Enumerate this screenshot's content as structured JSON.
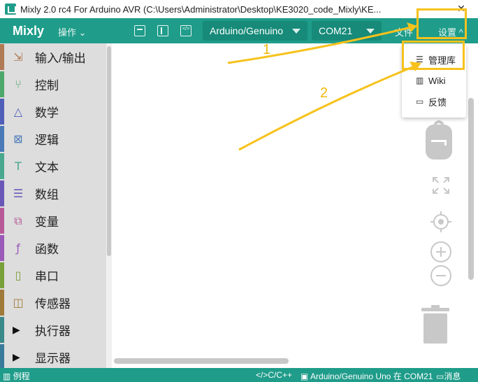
{
  "window": {
    "title": "Mixly 2.0 rc4 For Arduino AVR (C:\\Users\\Administrator\\Desktop\\KE3020_code_Mixly\\KE...",
    "minimize_glyph": "—",
    "close_glyph": "✕"
  },
  "header": {
    "brand": "Mixly",
    "operations_label": "操作",
    "board_select": "Arduino/Genuino",
    "port_select": "COM21",
    "file_menu": "文件",
    "settings_menu": "设置"
  },
  "toolbox": {
    "categories": [
      {
        "label": "输入/输出",
        "color": "#b07a54",
        "icon": "in-out-icon"
      },
      {
        "label": "控制",
        "color": "#4ea86b",
        "icon": "control-icon"
      },
      {
        "label": "数学",
        "color": "#5060b8",
        "icon": "math-icon"
      },
      {
        "label": "逻辑",
        "color": "#4a7ab8",
        "icon": "logic-icon"
      },
      {
        "label": "文本",
        "color": "#4aa88e",
        "icon": "text-icon"
      },
      {
        "label": "数组",
        "color": "#6a58b8",
        "icon": "array-icon"
      },
      {
        "label": "变量",
        "color": "#b85a9a",
        "icon": "variable-icon"
      },
      {
        "label": "函数",
        "color": "#9a5ab8",
        "icon": "function-icon"
      },
      {
        "label": "串口",
        "color": "#7aa03a",
        "icon": "serial-icon"
      },
      {
        "label": "传感器",
        "color": "#a07a3a",
        "icon": "sensor-icon"
      },
      {
        "label": "执行器",
        "color": "#3a8a8a",
        "icon": "actuator-icon"
      },
      {
        "label": "显示器",
        "color": "#3a7a9a",
        "icon": "display-icon"
      }
    ]
  },
  "settings_dropdown": {
    "items": [
      {
        "label": "管理库",
        "icon": "list-icon"
      },
      {
        "label": "Wiki",
        "icon": "book-icon"
      },
      {
        "label": "反馈",
        "icon": "comment-icon"
      }
    ]
  },
  "annotations": {
    "step1": "1",
    "step2": "2",
    "color": "#f7c21c"
  },
  "statusbar": {
    "examples": "例程",
    "language": "C/C++",
    "board_status": "Arduino/Genuino Uno 在 COM21",
    "messages": "消息"
  },
  "colors": {
    "brand": "#1f9c8a",
    "brand_dark": "#178a79",
    "toolbox_bg": "#dddddd",
    "control_gray": "#c8c8c8"
  }
}
